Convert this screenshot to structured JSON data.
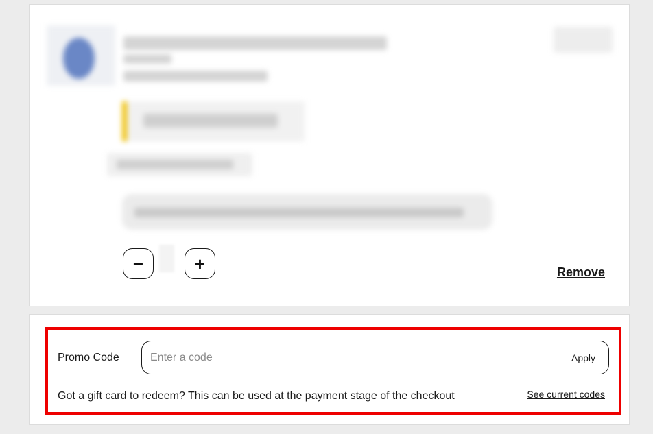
{
  "cart_item": {
    "quantity_decrease_symbol": "−",
    "quantity_increase_symbol": "+",
    "remove_label": "Remove"
  },
  "promo": {
    "label": "Promo Code",
    "input_value": "",
    "input_placeholder": "Enter a code",
    "apply_label": "Apply",
    "gift_card_text": "Got a gift card to redeem? This can be used at the payment stage of the checkout",
    "see_codes_label": "See current codes"
  },
  "colors": {
    "highlight_border": "#ee0000",
    "offer_accent": "#f0c000",
    "page_background": "#ececec"
  },
  "icons": {
    "minus": "minus-icon",
    "plus": "plus-icon"
  }
}
